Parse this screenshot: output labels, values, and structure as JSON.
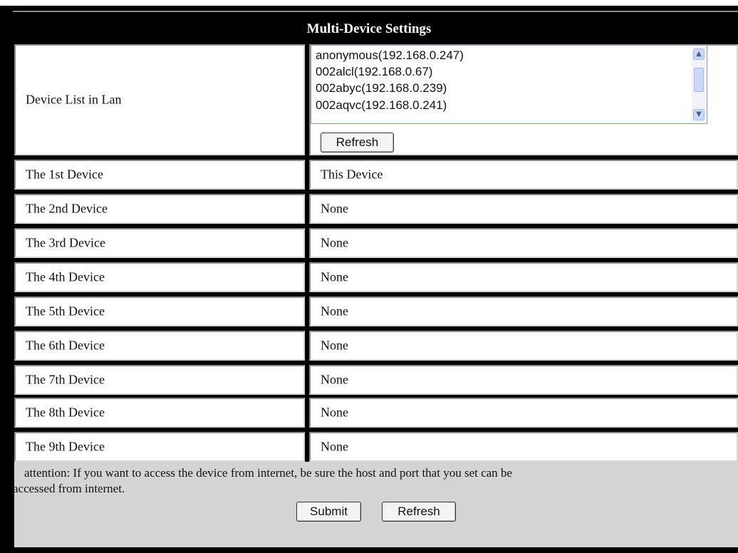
{
  "title": "Multi-Device Settings",
  "device_list": {
    "label": "Device List in Lan",
    "items": [
      "anonymous(192.168.0.247)",
      "002alcl(192.168.0.67)",
      "002abyc(192.168.0.239)",
      "002aqvc(192.168.0.241)"
    ],
    "refresh_label": "Refresh"
  },
  "devices": [
    {
      "label": "The 1st Device",
      "value": "This Device"
    },
    {
      "label": "The 2nd Device",
      "value": "None"
    },
    {
      "label": "The 3rd Device",
      "value": "None"
    },
    {
      "label": "The 4th Device",
      "value": "None"
    },
    {
      "label": "The 5th Device",
      "value": "None"
    },
    {
      "label": "The 6th Device",
      "value": "None"
    },
    {
      "label": "The 7th Device",
      "value": "None"
    },
    {
      "label": "The 8th Device",
      "value": "None"
    },
    {
      "label": "The 9th Device",
      "value": "None"
    }
  ],
  "footer": {
    "attention_line1": "attention: If you want to access the device from internet, be sure the host and port that you set can be",
    "attention_line2": "accessed from internet.",
    "submit_label": "Submit",
    "refresh_label": "Refresh"
  },
  "colors": {
    "header_bg": "#000000",
    "footer_bg": "#d4d4d4"
  }
}
